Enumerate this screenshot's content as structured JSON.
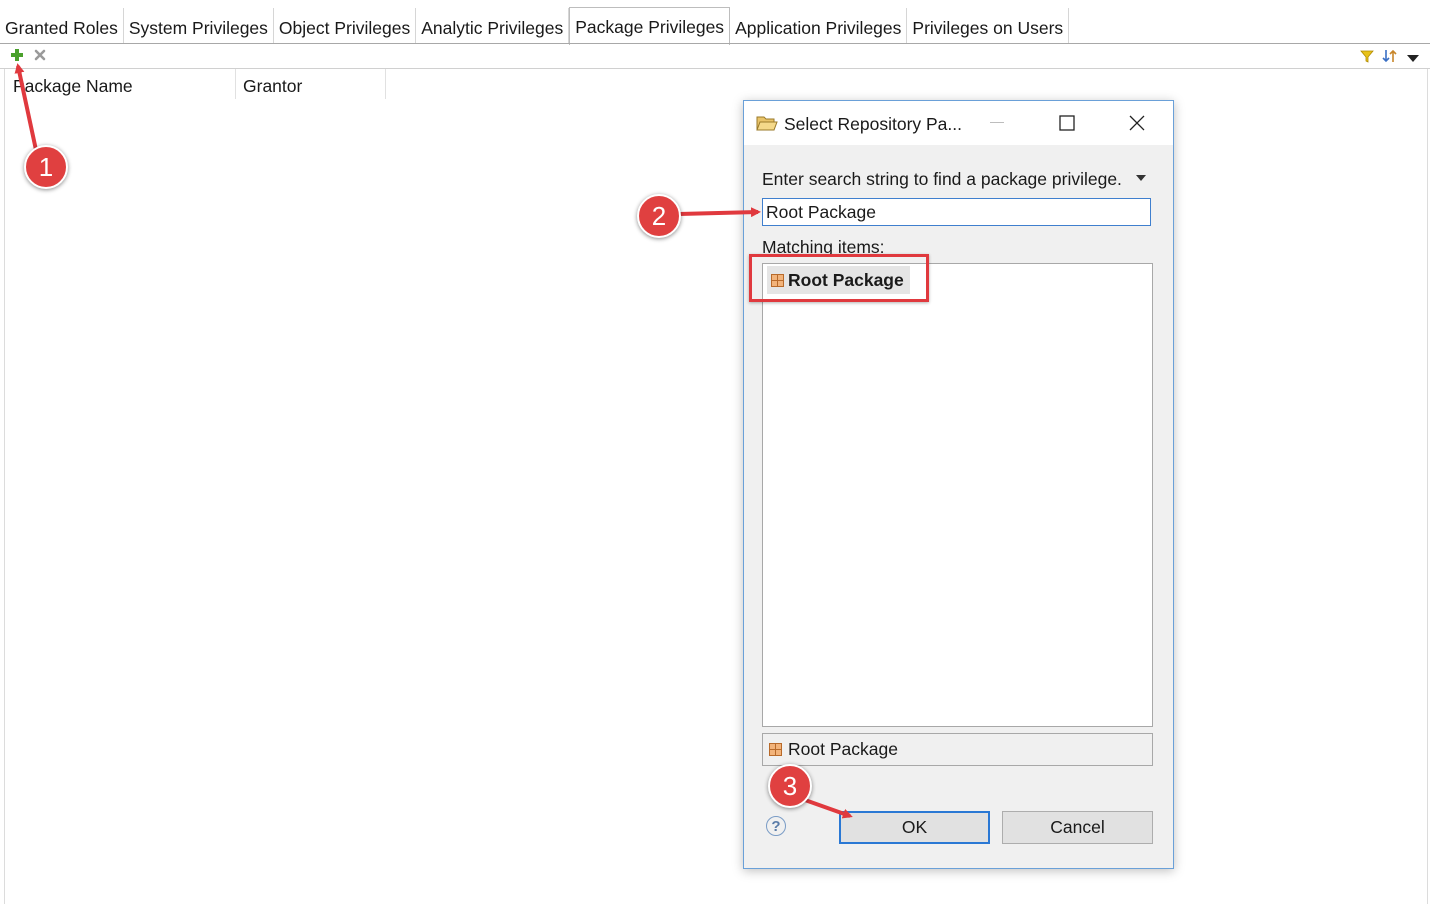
{
  "tabs": [
    {
      "label": "Granted Roles"
    },
    {
      "label": "System Privileges"
    },
    {
      "label": "Object Privileges"
    },
    {
      "label": "Analytic Privileges"
    },
    {
      "label": "Package Privileges"
    },
    {
      "label": "Application Privileges"
    },
    {
      "label": "Privileges on Users"
    }
  ],
  "active_tab": "Package Privileges",
  "toolbar": {
    "left_icons": [
      "add-icon",
      "remove-icon"
    ],
    "right_icons": [
      "filter-icon",
      "sort-icon",
      "view-menu-icon"
    ]
  },
  "table": {
    "columns": [
      {
        "label": "Package Name"
      },
      {
        "label": "Grantor"
      }
    ]
  },
  "dialog": {
    "title": "Select Repository Pa...",
    "title_icon": "folder-open-icon",
    "prompt": "Enter search string to find a package privilege.",
    "search_value": "Root Package",
    "matching_label": "Matching items:",
    "matching_items": [
      {
        "label": "Root Package",
        "icon": "package-icon"
      }
    ],
    "selected_item": {
      "label": "Root Package",
      "icon": "package-icon"
    },
    "ok_label": "OK",
    "cancel_label": "Cancel",
    "help_symbol": "?"
  },
  "annotations": {
    "callouts": [
      "1",
      "2",
      "3"
    ],
    "color": "#e0393e"
  },
  "colors": {
    "add_icon": "#4aa02c",
    "focus_border": "#2a78d4",
    "callout_red": "#e04040"
  }
}
